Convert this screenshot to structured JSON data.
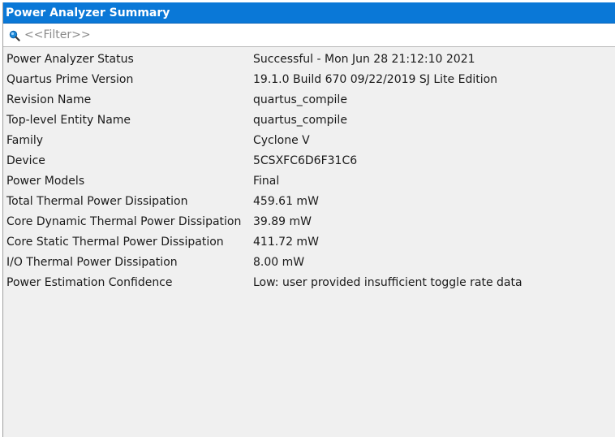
{
  "panel": {
    "title": "Power Analyzer Summary",
    "accent_color": "#0a78d7"
  },
  "filter": {
    "placeholder": "<<Filter>>",
    "value": "",
    "icon": "search-icon"
  },
  "rows": [
    {
      "label": "Power Analyzer Status",
      "value": "Successful - Mon Jun 28 21:12:10 2021"
    },
    {
      "label": "Quartus Prime Version",
      "value": "19.1.0 Build 670 09/22/2019 SJ Lite Edition"
    },
    {
      "label": "Revision Name",
      "value": "quartus_compile"
    },
    {
      "label": "Top-level Entity Name",
      "value": "quartus_compile"
    },
    {
      "label": "Family",
      "value": "Cyclone V"
    },
    {
      "label": "Device",
      "value": "5CSXFC6D6F31C6"
    },
    {
      "label": "Power Models",
      "value": "Final"
    },
    {
      "label": "Total Thermal Power Dissipation",
      "value": "459.61 mW"
    },
    {
      "label": "Core Dynamic Thermal Power Dissipation",
      "value": "39.89 mW"
    },
    {
      "label": "Core Static Thermal Power Dissipation",
      "value": "411.72 mW"
    },
    {
      "label": "I/O Thermal Power Dissipation",
      "value": "8.00 mW"
    },
    {
      "label": "Power Estimation Confidence",
      "value": "Low: user provided insufficient toggle rate data"
    }
  ]
}
